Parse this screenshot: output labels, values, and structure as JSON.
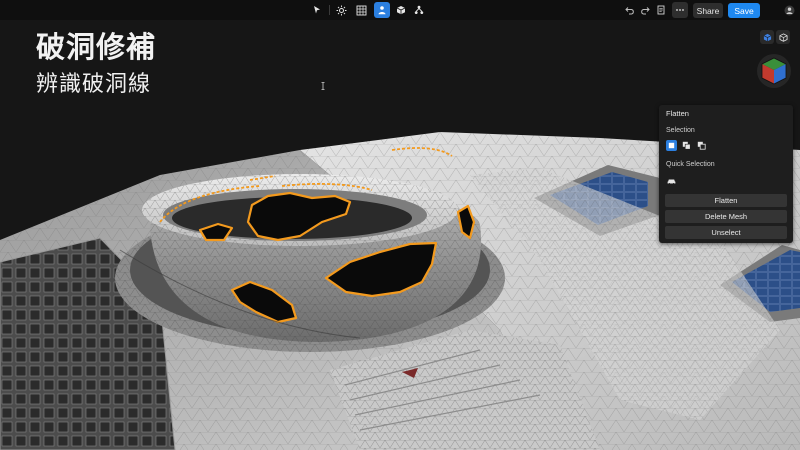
{
  "toolbar": {
    "tools": [
      {
        "name": "select-tool",
        "icon": "cursor-arrow-icon"
      },
      {
        "name": "measure-tool",
        "icon": "sun-icon"
      },
      {
        "name": "grid-tool",
        "icon": "grid-icon"
      },
      {
        "name": "person-tool",
        "icon": "person-icon",
        "active": true
      },
      {
        "name": "mesh-tool",
        "icon": "cube-icon"
      },
      {
        "name": "scene-tool",
        "icon": "tree-icon"
      }
    ],
    "right_tools": [
      "undo-icon",
      "redo-icon",
      "document-icon",
      "more-icon"
    ],
    "share_label": "Share",
    "save_label": "Save",
    "accent": "#1e88f0"
  },
  "overlay": {
    "title": "破洞修補",
    "subtitle": "辨識破洞線"
  },
  "flatten_panel": {
    "title": "Flatten",
    "selection_label": "Selection",
    "selection_modes": [
      "single-select-icon",
      "add-select-icon",
      "subtract-select-icon"
    ],
    "quick_selection_label": "Quick Selection",
    "quick_icon": "car-icon",
    "buttons": {
      "flatten": "Flatten",
      "delete_mesh": "Delete Mesh",
      "unselect": "Unselect"
    }
  },
  "highlight_color": "#f39a1e"
}
